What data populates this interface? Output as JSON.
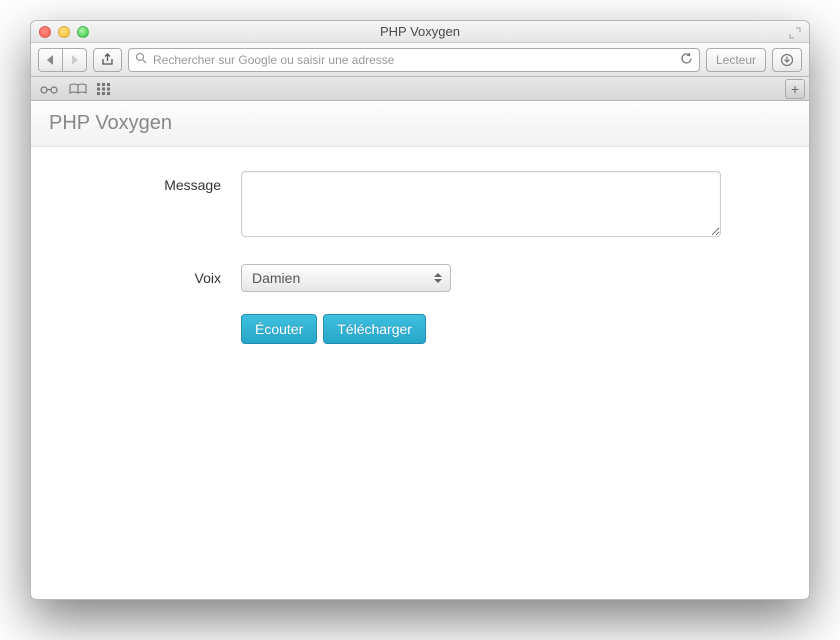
{
  "window": {
    "title": "PHP Voxygen"
  },
  "browser": {
    "address_placeholder": "Rechercher sur Google ou saisir une adresse",
    "reader_label": "Lecteur"
  },
  "app": {
    "brand": "PHP Voxygen",
    "form": {
      "message_label": "Message",
      "message_value": "",
      "voice_label": "Voix",
      "voice_selected": "Damien",
      "listen_button": "Écouter",
      "download_button": "Télécharger"
    }
  }
}
